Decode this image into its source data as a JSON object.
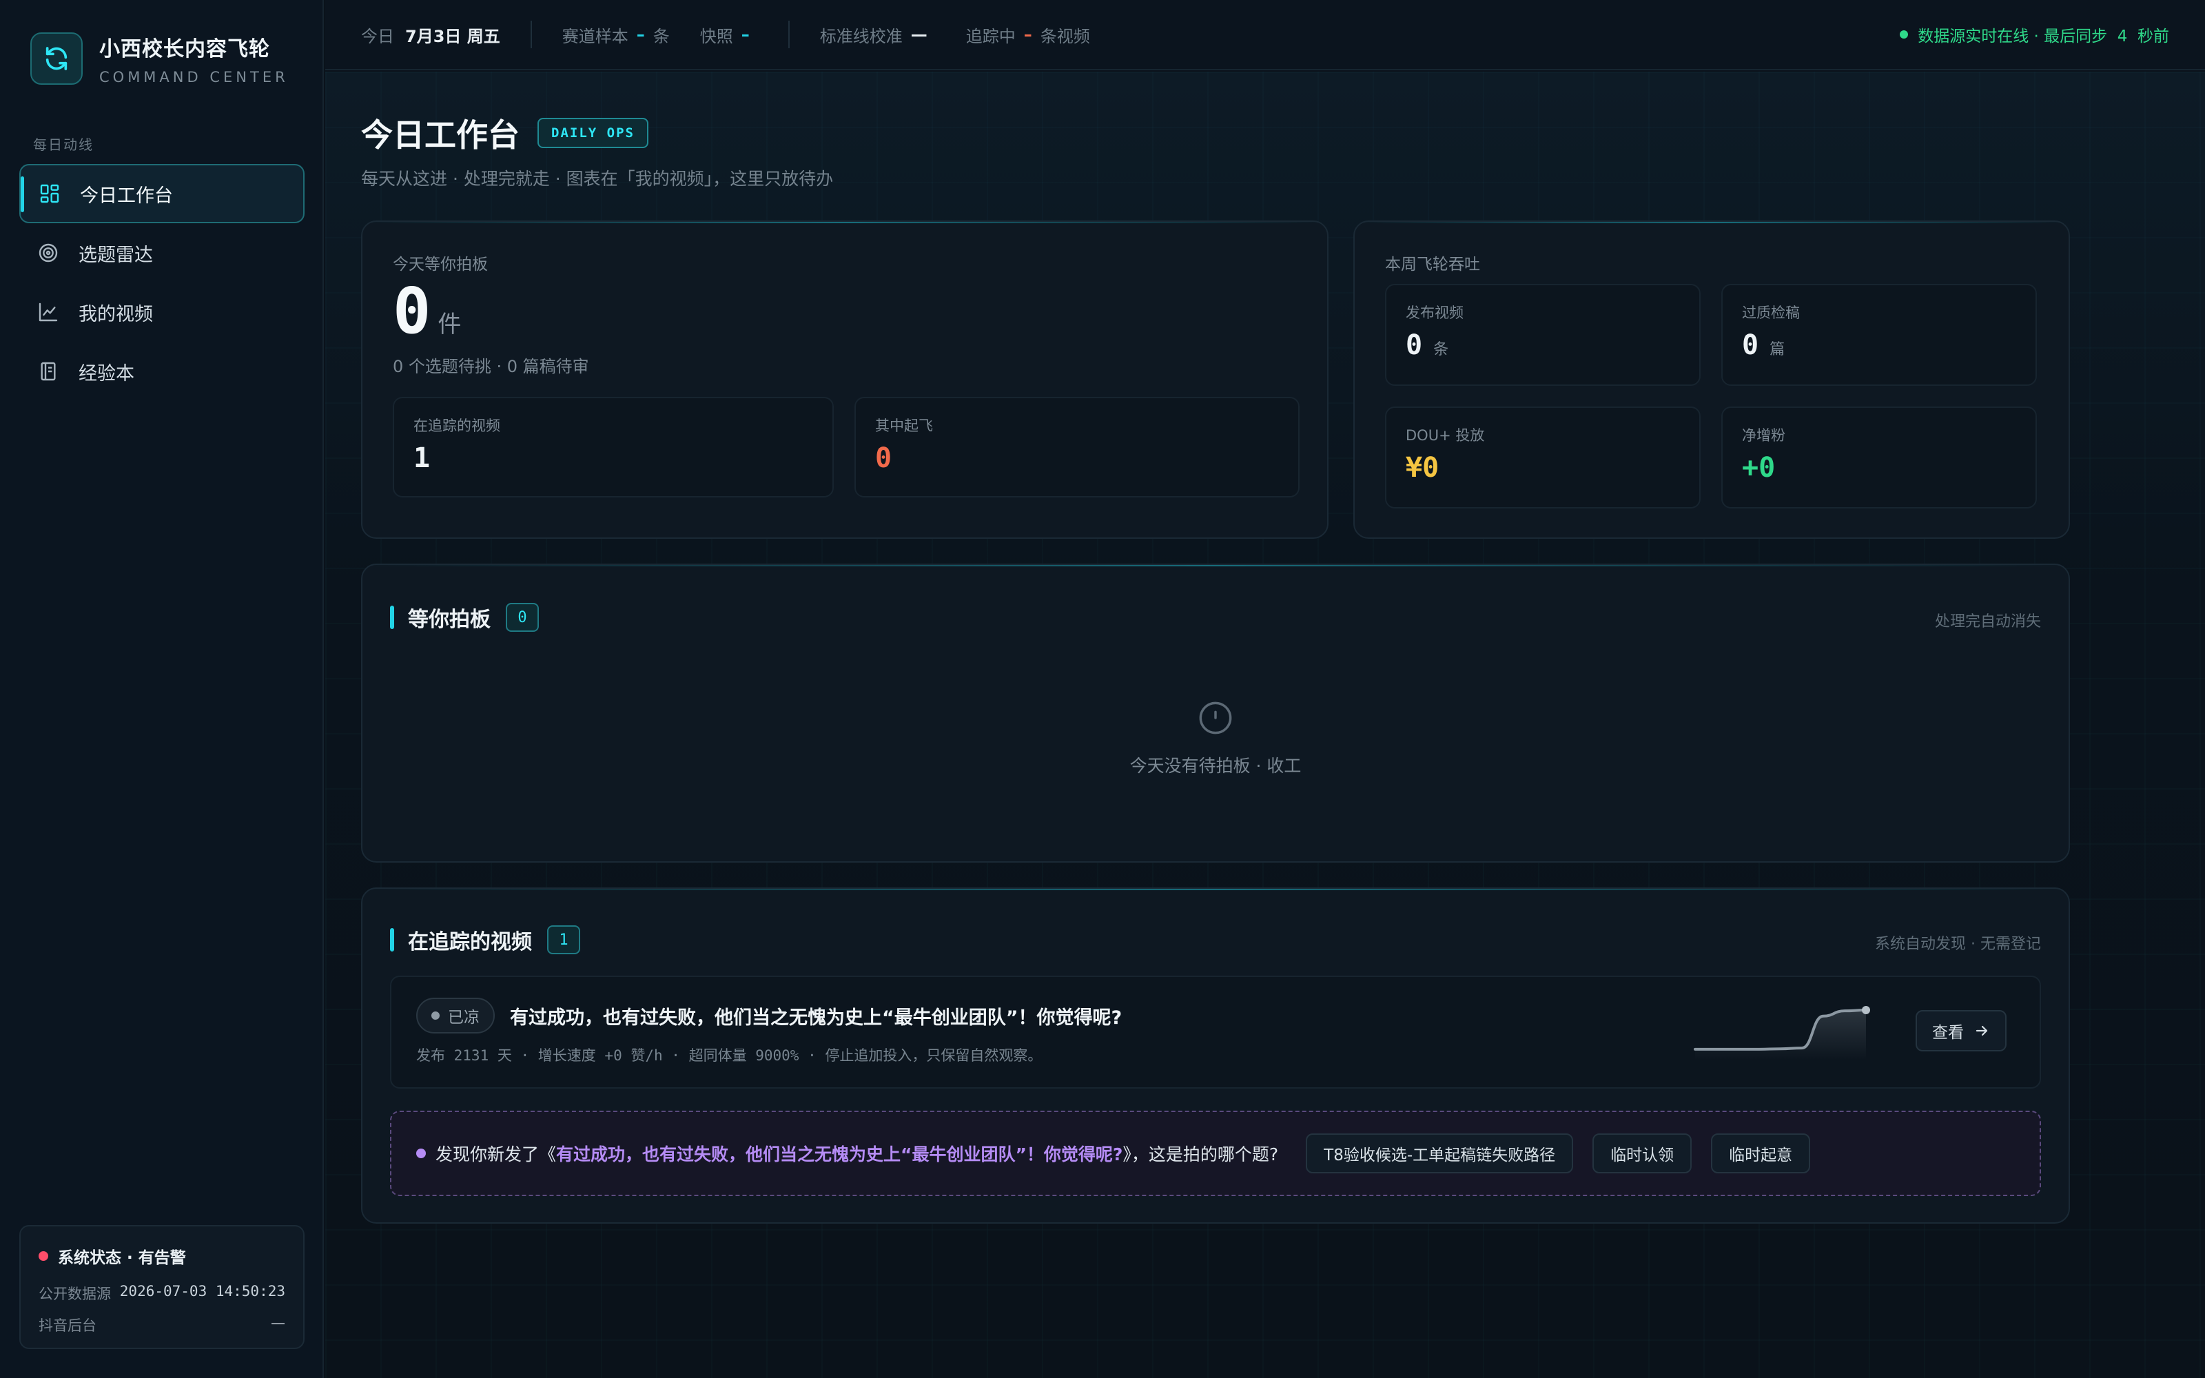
{
  "brand": {
    "title": "小西校长内容飞轮",
    "subtitle": "COMMAND CENTER"
  },
  "sidebar": {
    "section_label": "每日动线",
    "items": [
      {
        "label": "今日工作台",
        "icon": "dashboard-icon",
        "active": true
      },
      {
        "label": "选题雷达",
        "icon": "radar-icon",
        "active": false
      },
      {
        "label": "我的视频",
        "icon": "chart-line-icon",
        "active": false
      },
      {
        "label": "经验本",
        "icon": "notebook-icon",
        "active": false
      }
    ],
    "status": {
      "title": "系统状态 · 有告警",
      "rows": [
        {
          "label": "公开数据源",
          "value": "2026-07-03 14:50:23"
        },
        {
          "label": "抖音后台",
          "value": "—"
        }
      ]
    }
  },
  "topbar": {
    "today_label": "今日",
    "today_value": "7月3日 周五",
    "track_label": "赛道样本",
    "track_value": "–",
    "track_unit": "条",
    "snapshot_label": "快照",
    "snapshot_value": "–",
    "baseline_label": "标准线校准",
    "baseline_value": "—",
    "tracking_label": "追踪中",
    "tracking_value": "–",
    "tracking_unit": "条视频",
    "sync_status": "数据源实时在线 · 最后同步  4  秒前"
  },
  "page": {
    "title": "今日工作台",
    "tag": "DAILY OPS",
    "subtitle": "每天从这进 · 处理完就走 · 图表在「我的视频」，这里只放待办"
  },
  "today_card": {
    "label": "今天等你拍板",
    "count": "0",
    "unit": "件",
    "detail": "0 个选题待挑 · 0 篇稿待审",
    "tracking_label": "在追踪的视频",
    "tracking_value": "1",
    "takeoff_label": "其中起飞",
    "takeoff_value": "0"
  },
  "week_card": {
    "label": "本周飞轮吞吐",
    "published_label": "发布视频",
    "published_value": "0",
    "published_unit": "条",
    "qc_label": "过质检稿",
    "qc_value": "0",
    "qc_unit": "篇",
    "dou_label": "DOU+ 投放",
    "dou_value": "¥0",
    "fans_label": "净增粉",
    "fans_value": "+0"
  },
  "pending_section": {
    "title": "等你拍板",
    "count": "0",
    "hint": "处理完自动消失",
    "empty_text": "今天没有待拍板 · 收工"
  },
  "tracking_section": {
    "title": "在追踪的视频",
    "count": "1",
    "hint": "系统自动发现 · 无需登记",
    "video": {
      "status": "已凉",
      "title": "有过成功，也有过失败，他们当之无愧为史上“最牛创业团队”！你觉得呢?",
      "meta": "发布 2131 天 · 增长速度 +0 赞/h · 超同体量 9000% · 停止追加投入，只保留自然观察。",
      "view_label": "查看",
      "spark": [
        0.02,
        0.02,
        0.02,
        0.02,
        0.03,
        0.05,
        0.85,
        0.98,
        1.0
      ]
    },
    "discovery": {
      "prefix": "发现你新发了《",
      "highlight": "有过成功，也有过失败，他们当之无愧为史上“最牛创业团队”！你觉得呢?",
      "suffix": "》，这是拍的哪个题?",
      "options": [
        "T8验收候选-工单起稿链失败路径",
        "临时认领",
        "临时起意"
      ]
    }
  },
  "colors": {
    "accent": "#22d3e6",
    "success": "#2fd98a",
    "danger": "#f26a4b",
    "warning": "#f5c542",
    "purple": "#b58cf5",
    "alert": "#ff4d6a"
  }
}
